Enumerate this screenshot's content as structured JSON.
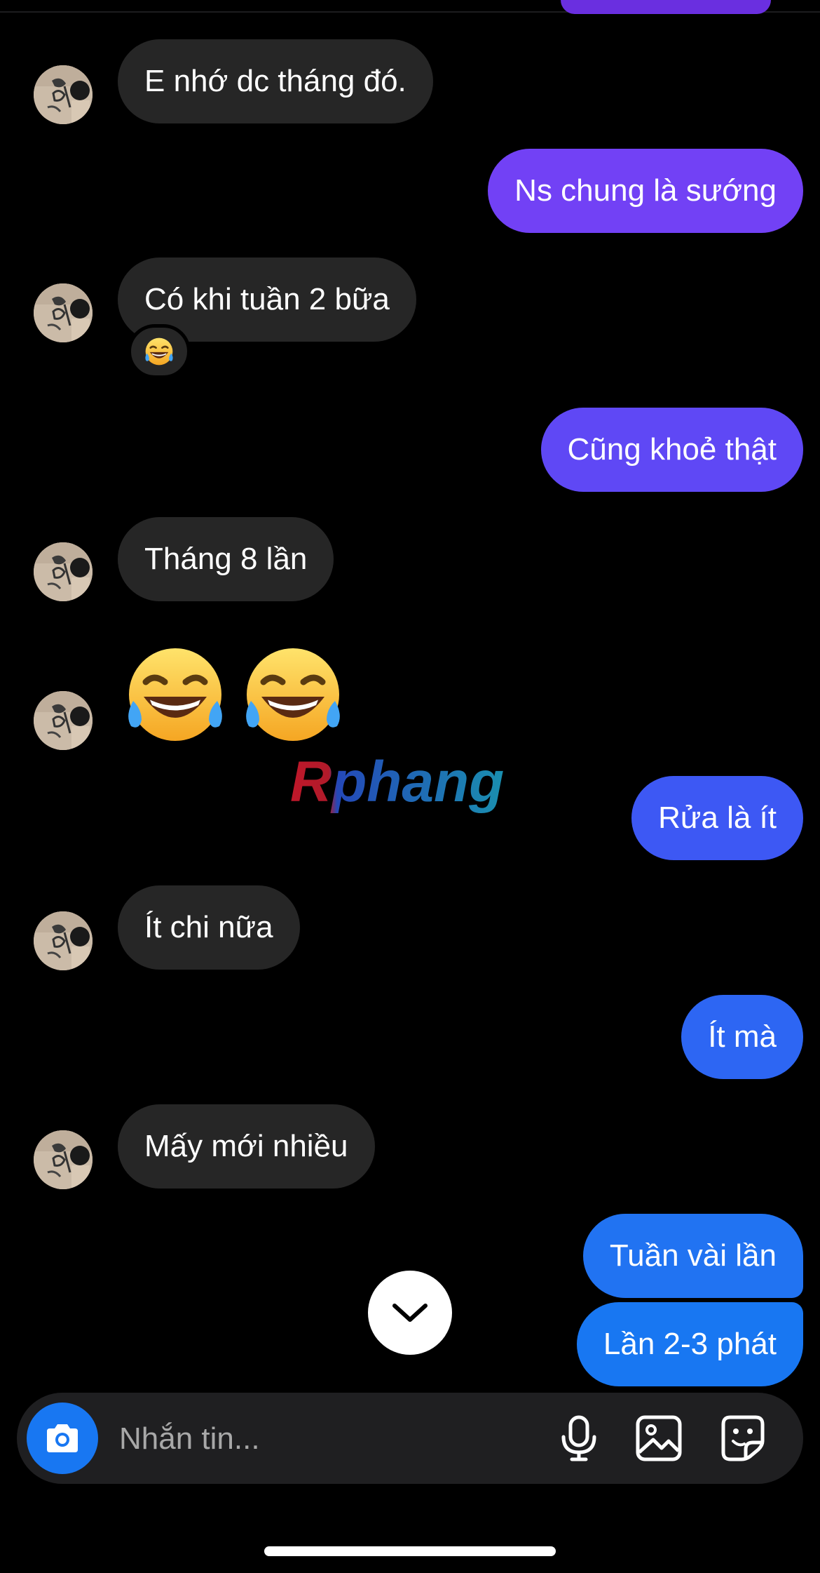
{
  "chat": {
    "messages": [
      {
        "side": "received",
        "text": "E nhớ dc tháng đó."
      },
      {
        "side": "sent",
        "text": "Ns chung là sướng"
      },
      {
        "side": "received",
        "text": "Có khi tuần 2 bữa",
        "reaction": "laughing-with-tears"
      },
      {
        "side": "sent",
        "text": "Cũng khoẻ thật"
      },
      {
        "side": "received",
        "text": "Tháng 8 lần"
      },
      {
        "side": "received",
        "emoji": [
          "laughing-with-tears",
          "laughing-with-tears"
        ]
      },
      {
        "side": "sent",
        "text": "Rửa là ít"
      },
      {
        "side": "received",
        "text": "Ít chi nữa"
      },
      {
        "side": "sent",
        "text": "Ít mà"
      },
      {
        "side": "received",
        "text": "Mấy mới nhiều"
      },
      {
        "side": "sent",
        "text": "Tuần vài lần"
      },
      {
        "side": "sent",
        "text": "Lần 2-3 phát"
      }
    ]
  },
  "watermark": {
    "text": "Rphang"
  },
  "composer": {
    "placeholder": "Nhắn tin...",
    "icons": [
      "camera-icon",
      "microphone-icon",
      "gallery-icon",
      "sticker-icon"
    ]
  },
  "colors": {
    "background": "#000000",
    "received_bubble": "#262626",
    "sent_gradient_top": "#7b3ff5",
    "sent_gradient_bottom": "#1877f2",
    "accent": "#1877f2",
    "composer_bg": "#1f1f21"
  }
}
